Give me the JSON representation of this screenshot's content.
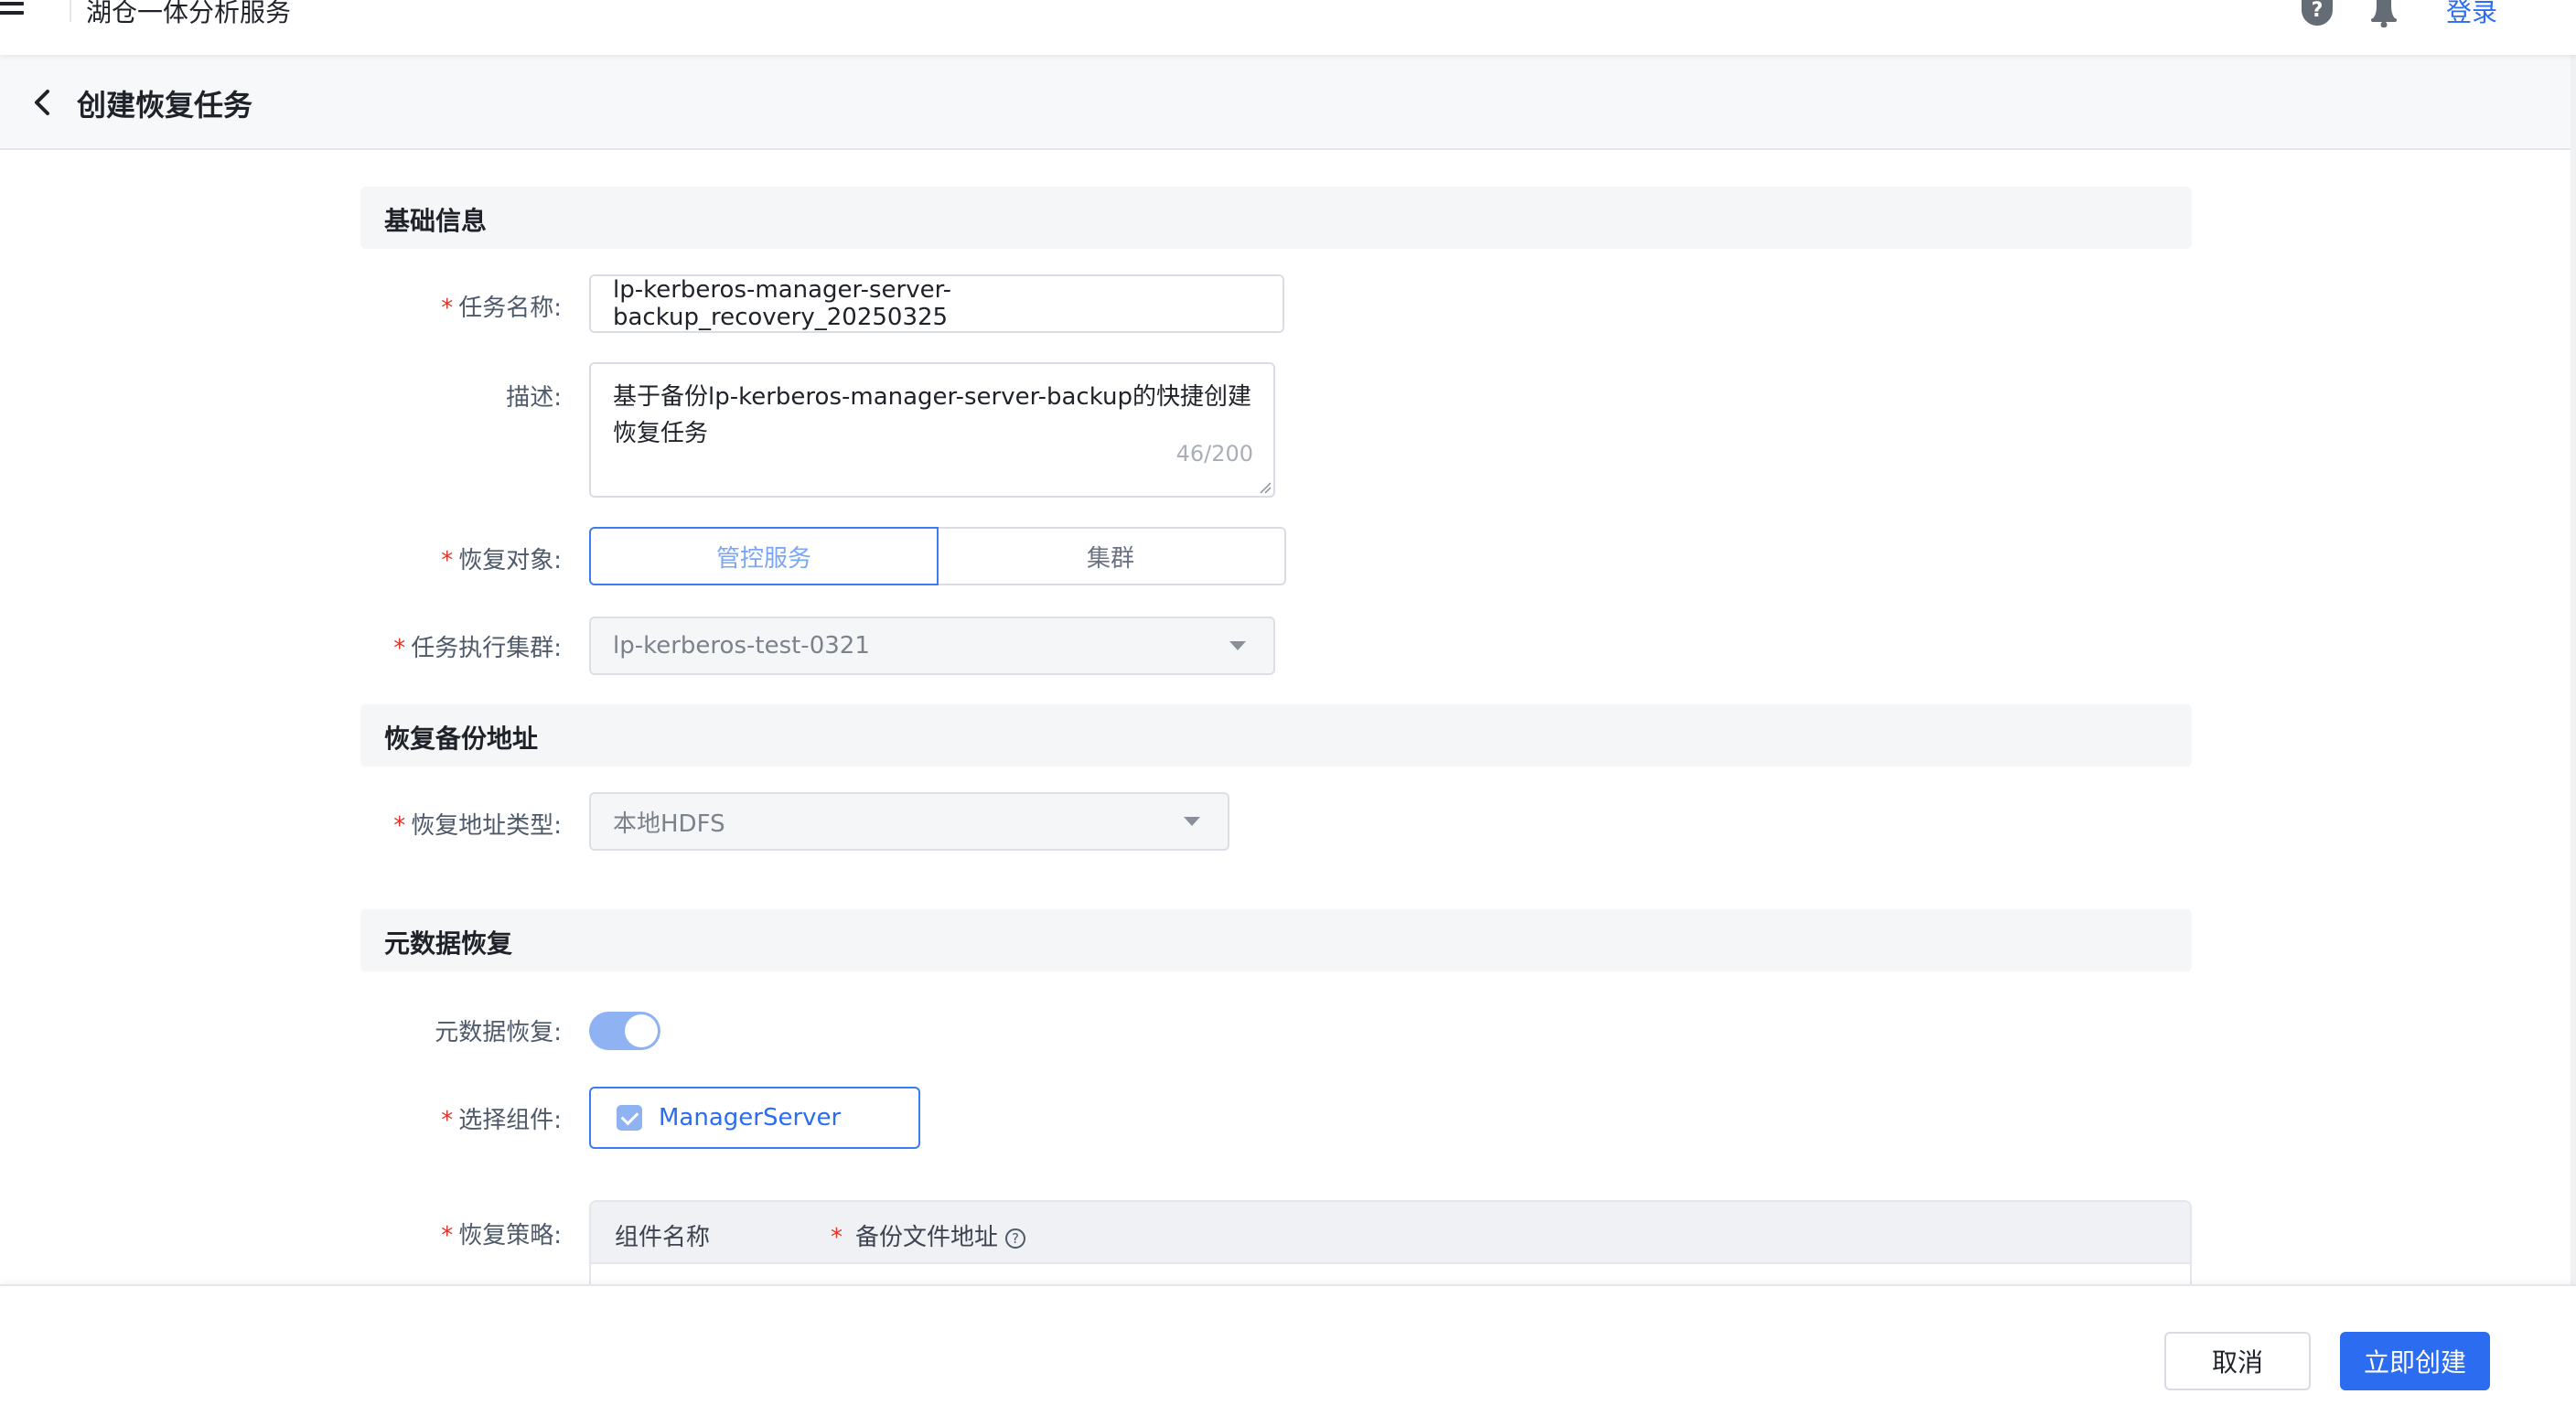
{
  "header": {
    "app_title": "湖仓一体分析服务",
    "login_label": "登录",
    "menu_icon": "hamburger-menu-icon",
    "help_icon": "question-circle-icon",
    "bell_icon": "bell-icon"
  },
  "subheader": {
    "title": "创建恢复任务",
    "back_icon": "chevron-left-icon"
  },
  "sections": {
    "basic": {
      "title": "基础信息"
    },
    "address": {
      "title": "恢复备份地址"
    },
    "metadata": {
      "title": "元数据恢复"
    }
  },
  "form": {
    "required_mark": "*",
    "task_name": {
      "label": "任务名称:",
      "value": "lp-kerberos-manager-server-backup_recovery_20250325"
    },
    "description": {
      "label": "描述:",
      "value": "基于备份lp-kerberos-manager-server-backup的快捷创建恢复任务",
      "counter": "46/200"
    },
    "restore_target": {
      "label": "恢复对象:",
      "options": [
        "管控服务",
        "集群"
      ],
      "selected": "管控服务"
    },
    "exec_cluster": {
      "label": "任务执行集群:",
      "value": "lp-kerberos-test-0321"
    },
    "address_type": {
      "label": "恢复地址类型:",
      "value": "本地HDFS"
    },
    "metadata_restore": {
      "label": "元数据恢复:",
      "enabled": true
    },
    "components": {
      "label": "选择组件:",
      "option": "ManagerServer",
      "checked": true
    },
    "strategy": {
      "label": "恢复策略:",
      "columns": [
        "组件名称",
        "备份文件地址"
      ]
    }
  },
  "footer": {
    "cancel_label": "取消",
    "create_label": "立即创建"
  },
  "colors": {
    "primary": "#2b6cf0",
    "required": "#e0362c",
    "toggle_on": "#8fb3f2"
  }
}
